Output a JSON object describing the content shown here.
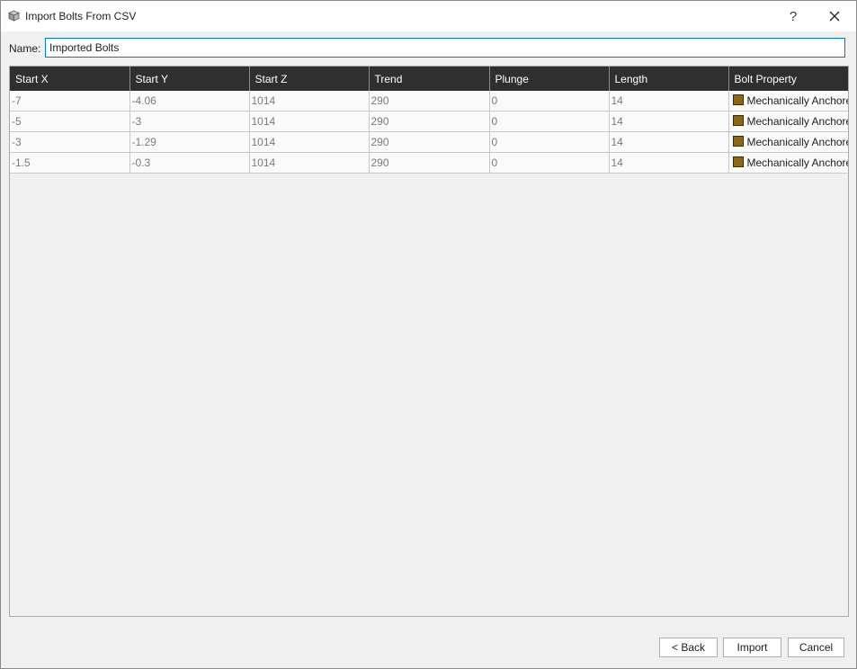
{
  "window": {
    "title": "Import Bolts From CSV",
    "help_label": "?"
  },
  "name_field": {
    "label": "Name:",
    "value": "Imported Bolts"
  },
  "grid": {
    "columns": [
      "Start X",
      "Start Y",
      "Start Z",
      "Trend",
      "Plunge",
      "Length",
      "Bolt Property"
    ],
    "rows": [
      [
        "-7",
        "-4.06",
        "1014",
        "290",
        "0",
        "14",
        "Mechanically Anchored"
      ],
      [
        "-5",
        "-3",
        "1014",
        "290",
        "0",
        "14",
        "Mechanically Anchored"
      ],
      [
        "-3",
        "-1.29",
        "1014",
        "290",
        "0",
        "14",
        "Mechanically Anchored"
      ],
      [
        "-1.5",
        "-0.3",
        "1014",
        "290",
        "0",
        "14",
        "Mechanically Anchored"
      ]
    ],
    "property_swatch_color": "#8b6914"
  },
  "buttons": {
    "back": "< Back",
    "import": "Import",
    "cancel": "Cancel"
  },
  "icons": {
    "app": "cube-icon",
    "close": "close-icon"
  }
}
